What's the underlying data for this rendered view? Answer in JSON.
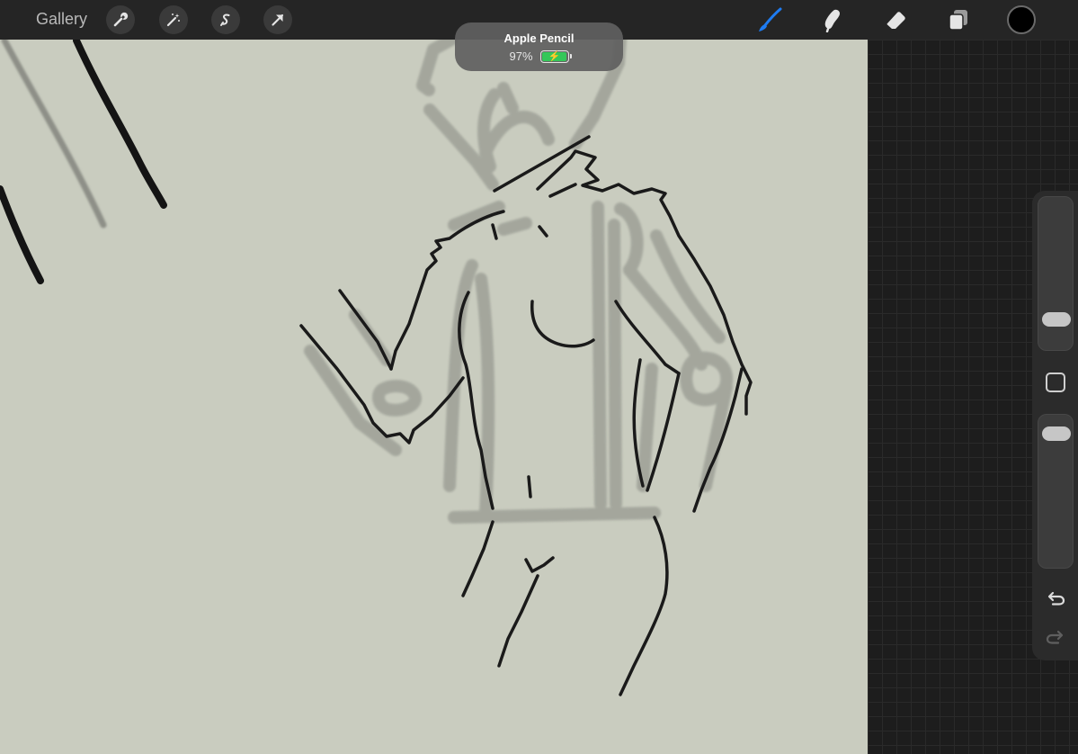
{
  "topbar": {
    "gallery_label": "Gallery",
    "left_tools": [
      "wrench-icon",
      "magic-wand-icon",
      "selection-icon",
      "transform-icon"
    ],
    "right_tools": [
      "brush-icon",
      "smudge-icon",
      "eraser-icon",
      "layers-icon"
    ],
    "active_tool": "brush",
    "accent_color": "#1e7cf2",
    "current_color": "#000000"
  },
  "toast": {
    "title": "Apple Pencil",
    "battery_percent": "97%",
    "battery_level": 0.97,
    "charging": true,
    "battery_color": "#34c759"
  },
  "sidebar": {
    "brush_size_level": 0.15,
    "opacity_level": 0.95,
    "modify_button": "square-icon",
    "undo": "undo-icon",
    "redo": "redo-icon"
  },
  "canvas": {
    "background_color": "#c9ccbf"
  }
}
